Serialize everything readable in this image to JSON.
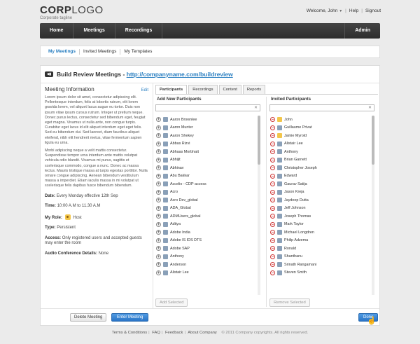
{
  "brand": {
    "logo_bold": "CORP",
    "logo_rest": "LOGO",
    "tagline": "Corporate tagline"
  },
  "userbar": {
    "welcome": "Welcome, John",
    "help": "Help",
    "signout": "Signout"
  },
  "topnav": {
    "home": "Home",
    "meetings": "Meetings",
    "recordings": "Recordings",
    "admin": "Admin"
  },
  "subnav": {
    "my_meetings": "My Meetings",
    "invited_meetings": "Invited Meetings",
    "my_templates": "My Templates"
  },
  "page": {
    "title_prefix": "Build Review Meetings - ",
    "title_link": "http://companyname.com/buildreview"
  },
  "info": {
    "heading": "Meeting Information",
    "edit": "Edit",
    "para1": "Lorem ipsum dolor sit amet, consectetur adipiscing elit. Pellentesque interdum, felis at lobortis rutrum, elit lorem gravida lorem, vel aliquet lacus augue eu tortor. Duis non ipsum vitae ipsum cursus rutrum. Integer ut pretium neque. Donec purus lectus, consectetur sed bibendum eget, feugiat eget magna. Vivamus ut nulla ante, non congue turpis. Curabitur eget lacus id elit aliquet interdum eget eget felis. Sed eu bibendum dui. Sed laoreet, diam faucibus aliquet eleifend, nibh elit hendrerit metus, vitae fermentum sapien ligula eu urna.",
    "para2": "Morbi adipiscing neque a velit mattis consectetur. Suspendisse tempor urna interdum ante mattis volutpat vehicula odio blandit. Vivamus mi purus, sagittis et scelerisque commodo, congue a nunc. Donec ac massa lectus. Mauris tristique massa at turpis egestas porttitor. Nulla ornare congue adipiscing. Aenean bibendum vestibulum massa a imperdiet. Etiam iaculis massa in mi volutpat ut scelerisque felis dapibus fusce bibendum bibendum.",
    "date_label": "Date:",
    "date_value": "Every Monday effective 12th Sep",
    "time_label": "Time:",
    "time_value": "10:00 A.M to 11.30 A.M",
    "role_label": "My Role:",
    "role_value": "Host",
    "type_label": "Type:",
    "type_value": "Persistent",
    "access_label": "Access:",
    "access_value": "Only registered users and accepted guests may enter the room",
    "audio_label": "Audio Conference Details:",
    "audio_value": "None"
  },
  "tabs": [
    "Participants",
    "Recordings",
    "Content",
    "Reports"
  ],
  "add_participants": {
    "title": "Add New Participants",
    "button": "Add Selected",
    "items": [
      "Aaron Brownlee",
      "Aaron Munter",
      "Aaron Shekey",
      "Abbas Rizvi",
      "Abhaas Morbhatt",
      "Abhijit",
      "Abhinav",
      "Abu Bakkar",
      "Accelio - CDP access",
      "Acro",
      "Acro Dev_global",
      "ADA_Global",
      "ADMUsers_global",
      "Aditya",
      "Adobe India",
      "Adobe IS IDS DTS",
      "Adobe SAP",
      "Anthony",
      "Anderson",
      "Alistair Lee"
    ]
  },
  "invited_participants": {
    "title": "Invited Participants",
    "button": "Remove Selected",
    "items": [
      "John",
      "Guillaume Privat",
      "Jamie Myrold",
      "Alistair Lee",
      "Anthony",
      "Brian Garnett",
      "Christopher Joseph",
      "Edward",
      "Gaurav Satija",
      "Jason Kreja",
      "Jaydeep Dutta",
      "Jeff Johnson",
      "Joseph Thomas",
      "Mark Taylor",
      "Michael Longdren",
      "Philip Adzema",
      "Ronald",
      "Shanthanu",
      "Srinath Rangamani",
      "Steven Smith"
    ]
  },
  "actions": {
    "delete": "Delete Meeting",
    "enter": "Enter Meeting",
    "done": "Done"
  },
  "footer": {
    "terms": "Terms & Conditions",
    "faq": "FAQ",
    "feedback": "Feedback",
    "about": "About Company",
    "copyright": "© 2011 Company copyrights. All rights reserved."
  },
  "colors": {
    "accent": "#2a7fc1",
    "nav_bg": "#333333",
    "remove": "#cc3333"
  }
}
